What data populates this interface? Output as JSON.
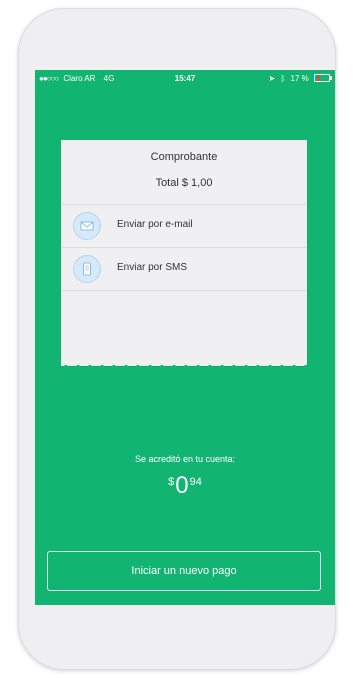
{
  "status_bar": {
    "carrier": "Claro AR",
    "network": "4G",
    "time": "15:47",
    "battery": "17 %",
    "battery_level": 0.17
  },
  "receipt": {
    "title": "Comprobante",
    "total": "Total $ 1,00",
    "options": [
      {
        "label": "Enviar por e-mail",
        "icon": "envelope-icon"
      },
      {
        "label": "Enviar por SMS",
        "icon": "phone-icon"
      }
    ]
  },
  "credit": {
    "label": "Se acreditó en tu cuenta:",
    "currency": "$",
    "integer": "0",
    "cents": "94"
  },
  "actions": {
    "new_payment_label": "Iniciar un nuevo pago"
  },
  "colors": {
    "screen_background": "#12b472",
    "receipt_background": "#f0f0f2",
    "icon_circle": "#d6e9f8",
    "battery_low": "#ff3b30"
  }
}
